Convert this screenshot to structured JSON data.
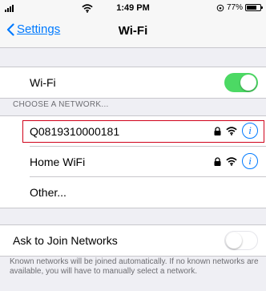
{
  "status_bar": {
    "time": "1:49 PM",
    "battery_percent": "77%",
    "battery_level": 0.77
  },
  "nav": {
    "back_label": "Settings",
    "title": "Wi-Fi"
  },
  "wifi_toggle": {
    "label": "Wi-Fi",
    "on": true
  },
  "network_section": {
    "header": "CHOOSE A NETWORK..."
  },
  "networks": [
    {
      "name": "Q0819310000181",
      "secured": true,
      "selected_highlight": true
    },
    {
      "name": "Home WiFi",
      "secured": true
    }
  ],
  "other_label": "Other...",
  "ask_to_join": {
    "label": "Ask to Join Networks",
    "on": false
  },
  "footer_text": "Known networks will be joined automatically. If no known networks are available, you will have to manually select a network.",
  "colors": {
    "accent": "#007aff",
    "toggle_on": "#4cd964",
    "highlight_border": "#d0021b"
  }
}
